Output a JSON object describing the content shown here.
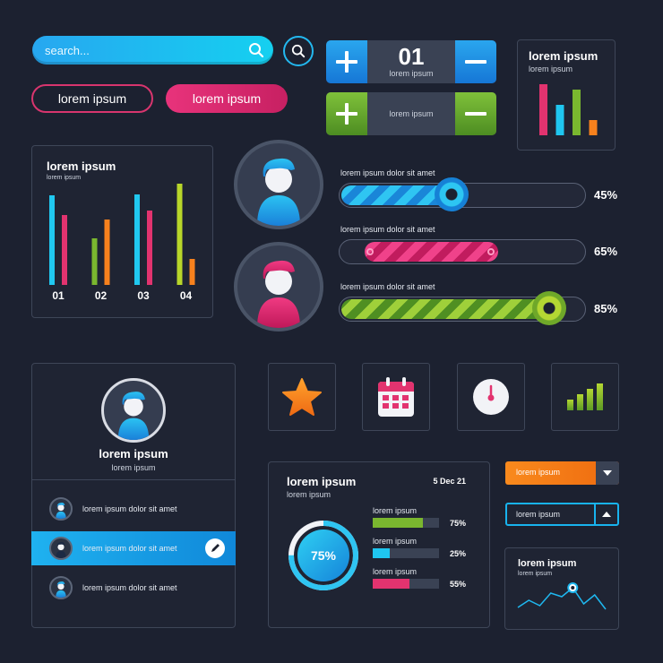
{
  "search": {
    "placeholder": "search..."
  },
  "buttons": {
    "outline_label": "lorem ipsum",
    "filled_label": "lorem ipsum"
  },
  "stepper1": {
    "value": "01",
    "label": "lorem ipsum"
  },
  "stepper2": {
    "label": "lorem ipsum"
  },
  "mini_chart": {
    "title": "lorem ipsum",
    "subtitle": "lorem ipsum",
    "chart_data": {
      "type": "bar",
      "values": [
        57,
        34,
        51,
        17
      ],
      "colors": [
        "#e2336f",
        "#1fc6f0",
        "#7ab72f",
        "#f7811d"
      ]
    }
  },
  "big_chart": {
    "title": "lorem ipsum",
    "subtitle": "lorem ipsum",
    "chart_data": {
      "type": "bar",
      "categories": [
        "01",
        "02",
        "03",
        "04"
      ],
      "series": [
        {
          "values": [
            100,
            52,
            101,
            113
          ]
        },
        {
          "values": [
            78,
            73,
            83,
            29
          ]
        }
      ],
      "colors_a": [
        "#20c8f0",
        "#7ab72f",
        "#20c8f0",
        "#b8d62a"
      ],
      "colors_b": [
        "#e2336f",
        "#f7811d",
        "#e2336f",
        "#f7811d"
      ]
    }
  },
  "sliders": [
    {
      "label": "lorem ipsum dolor sit amet",
      "value": "45%",
      "fraction": 0.45
    },
    {
      "label": "lorem ipsum dolor sit amet",
      "value": "65%",
      "fraction": 0.65
    },
    {
      "label": "lorem ipsum dolor sit amet",
      "value": "85%",
      "fraction": 0.85
    }
  ],
  "profile": {
    "name": "lorem ipsum",
    "subtitle": "lorem ipsum",
    "rows": [
      {
        "label": "lorem ipsum dolor sit amet"
      },
      {
        "label": "lorem ipsum dolor sit amet"
      },
      {
        "label": "lorem ipsum dolor sit amet"
      }
    ]
  },
  "stats": {
    "title": "lorem ipsum",
    "subtitle": "lorem ipsum",
    "date": "5 Dec 21",
    "ring_value": "75%",
    "ring_fraction": 0.75,
    "items": [
      {
        "label": "lorem ipsum",
        "value": "75%",
        "fraction": 0.75,
        "color": "#7ab72f"
      },
      {
        "label": "lorem ipsum",
        "value": "25%",
        "fraction": 0.25,
        "color": "#1fc6f0"
      },
      {
        "label": "lorem ipsum",
        "value": "55%",
        "fraction": 0.55,
        "color": "#e2336f"
      }
    ]
  },
  "dropdowns": [
    {
      "label": "lorem ipsum"
    },
    {
      "label": "lorem ipsum"
    }
  ],
  "line_card": {
    "title": "lorem ipsum",
    "subtitle": "lorem ipsum",
    "chart_data": {
      "type": "line",
      "values": [
        2,
        6,
        3,
        10,
        8,
        13,
        4,
        9,
        1
      ]
    }
  },
  "icons": [
    "star-icon",
    "calendar-icon",
    "clock-icon",
    "signal-bars-icon"
  ]
}
